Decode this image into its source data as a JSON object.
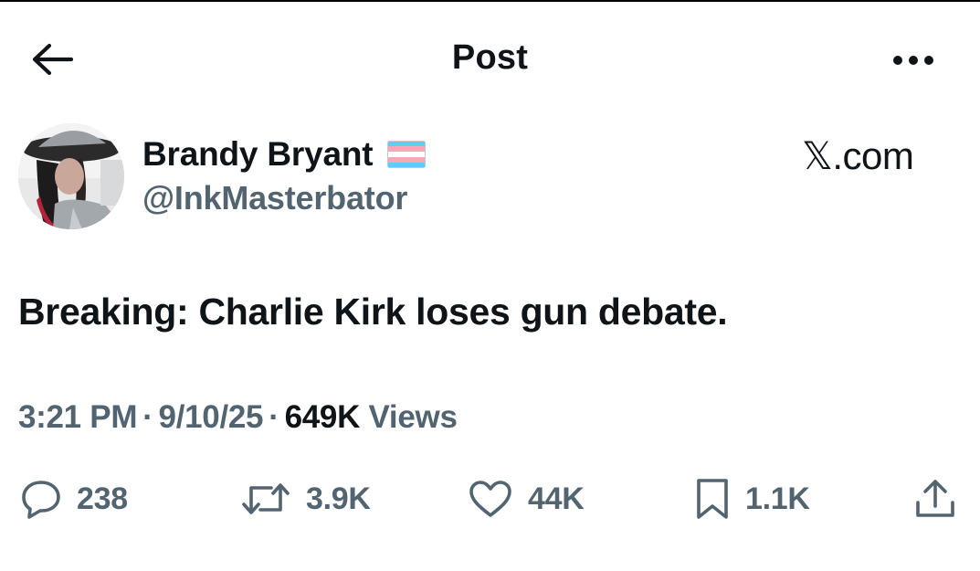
{
  "header": {
    "title": "Post",
    "back_icon": "arrow-left-icon",
    "more_icon": "more-horizontal-icon"
  },
  "author": {
    "name": "Brandy Bryant",
    "handle": "@InkMasterbator",
    "flag_icon": "transgender-flag-emoji",
    "avatar": "profile-photo"
  },
  "watermark": "𝕏.com",
  "tweet": {
    "text": "Breaking: Charlie Kirk loses gun debate."
  },
  "meta": {
    "time": "3:21 PM",
    "separator": "·",
    "date": "9/10/25",
    "views_count": "649K",
    "views_label": "Views"
  },
  "actions": {
    "replies": "238",
    "reposts": "3.9K",
    "likes": "44K",
    "bookmarks": "1.1K"
  },
  "colors": {
    "text_primary": "#0f1419",
    "text_secondary": "#536471",
    "background": "#ffffff",
    "flag_blue": "#5bcefa",
    "flag_pink": "#f5a9b8"
  }
}
